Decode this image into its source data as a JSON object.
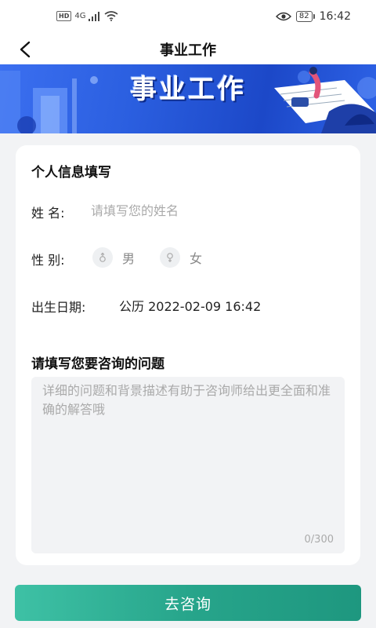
{
  "status_bar": {
    "hd": "HD",
    "network": "4G",
    "battery": "82",
    "time": "16:42"
  },
  "nav": {
    "title": "事业工作"
  },
  "banner": {
    "title": "事业工作"
  },
  "form": {
    "section_title": "个人信息填写",
    "name_label": "姓  名:",
    "name_placeholder": "请填写您的姓名",
    "name_value": "",
    "gender_label": "性  别:",
    "gender_options": [
      {
        "label": "男",
        "icon": "male-icon"
      },
      {
        "label": "女",
        "icon": "female-icon"
      }
    ],
    "birth_label": "出生日期:",
    "birth_value": "公历  2022-02-09 16:42",
    "question_title": "请填写您要咨询的问题",
    "question_placeholder": "详细的问题和背景描述有助于咨询师给出更全面和准确的解答哦",
    "question_value": "",
    "char_count": "0/300"
  },
  "submit": {
    "label": "去咨询"
  },
  "colors": {
    "banner_blue": "#2b5fe0",
    "accent_green": "#27a58b",
    "page_bg": "#f2f3f5"
  }
}
